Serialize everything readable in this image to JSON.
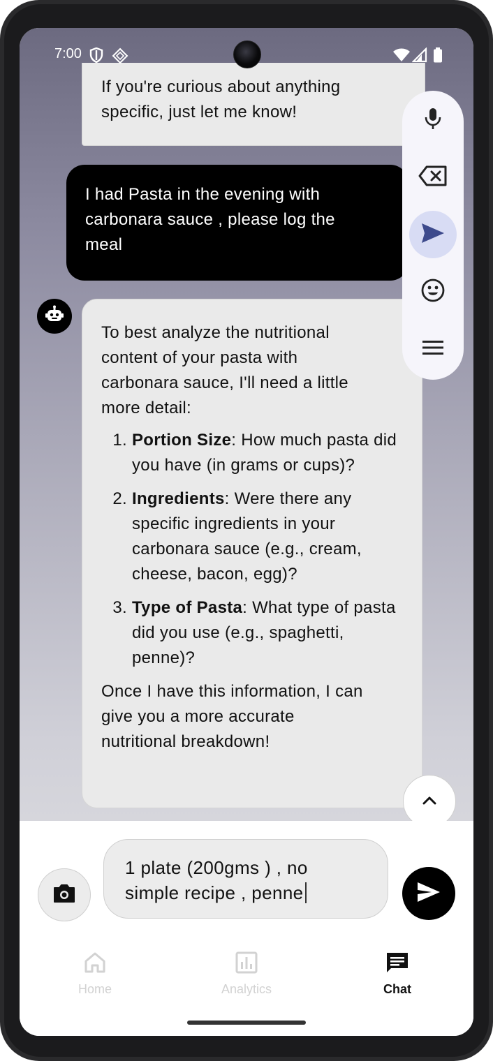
{
  "status_bar": {
    "time": "7:00"
  },
  "messages": {
    "bot_top": {
      "lines": [
        "If you're curious about anything",
        "specific, just let me know!"
      ]
    },
    "user": {
      "lines": [
        "I had Pasta in the evening with",
        "carbonara sauce , please log the",
        "meal"
      ]
    },
    "bot_reply": {
      "intro_lines": [
        "To best analyze the nutritional",
        "content of your pasta with",
        "carbonara sauce, I'll need a little",
        "more detail:"
      ],
      "items": [
        {
          "bold": "Portion Size",
          "text": ": How much pasta did you have (in grams or cups)?"
        },
        {
          "bold": "Ingredients",
          "text": ": Were there any specific ingredients in your carbonara sauce (e.g., cream, cheese, bacon, egg)?"
        },
        {
          "bold": "Type of Pasta",
          "text": ": What type of pasta did you use (e.g., spaghetti, penne)?"
        }
      ],
      "outro_lines": [
        "Once I have this information, I can",
        "give you a more accurate",
        "nutritional breakdown!"
      ]
    }
  },
  "input": {
    "line1": "1 plate (200gms ) , no",
    "line2": "simple recipe ,  penne"
  },
  "nav": {
    "home": "Home",
    "analytics": "Analytics",
    "chat": "Chat"
  },
  "colors": {
    "accent": "#000000",
    "active_float": "#d8dcf4",
    "send_float_icon": "#3d4a8c",
    "inactive_nav": "#d2d2d2"
  }
}
